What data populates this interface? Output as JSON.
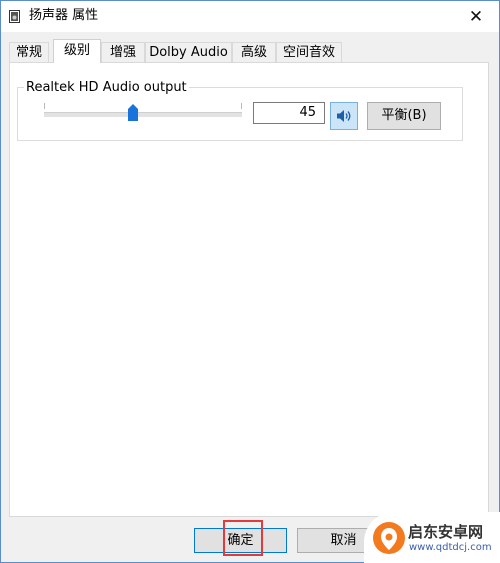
{
  "window": {
    "title": "扬声器 属性",
    "close_glyph": "✕"
  },
  "tabs": [
    {
      "label": "常规",
      "active": false
    },
    {
      "label": "级别",
      "active": true
    },
    {
      "label": "增强",
      "active": false
    },
    {
      "label": "Dolby Audio",
      "active": false
    },
    {
      "label": "高级",
      "active": false
    },
    {
      "label": "空间音效",
      "active": false
    }
  ],
  "levels": {
    "device_label": "Realtek HD Audio output",
    "volume_value": "45",
    "volume_level": 45,
    "speaker_icon": "speaker-icon",
    "balance_label": "平衡(B)"
  },
  "footer": {
    "ok_label": "确定",
    "cancel_label": "取消"
  },
  "watermark": {
    "name": "启东安卓网",
    "url": "www.qdtdcj.com"
  },
  "colors": {
    "accent": "#0078d7",
    "thumb": "#1a73d9",
    "highlight": "#e33b3b"
  }
}
